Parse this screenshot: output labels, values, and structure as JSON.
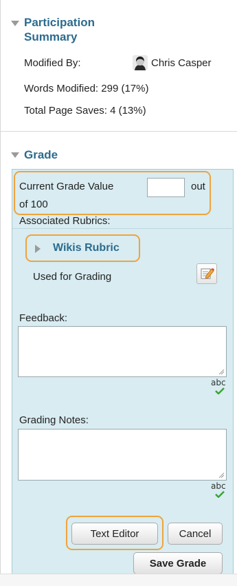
{
  "participation": {
    "title_line1": "Participation",
    "title_line2": "Summary",
    "modified_by_label": "Modified By:",
    "modified_by_name": "Chris Casper",
    "words_modified": "Words Modified: 299 (17%)",
    "total_page_saves": "Total Page Saves: 4 (13%)"
  },
  "grade": {
    "title": "Grade",
    "current_grade_label": "Current Grade Value",
    "grade_input_value": "",
    "out_of_part1": "out",
    "out_of_part2": "of 100",
    "associated_rubrics_label": "Associated Rubrics:",
    "rubric_name": "Wikis Rubric",
    "used_for_grading": "Used for Grading",
    "feedback_label": "Feedback:",
    "feedback_value": "",
    "grading_notes_label": "Grading Notes:",
    "grading_notes_value": "",
    "spellcheck_text": "abc",
    "buttons": {
      "text_editor": "Text Editor",
      "cancel": "Cancel",
      "save_grade": "Save Grade"
    }
  },
  "colors": {
    "link": "#2c6b8e",
    "panel": "#d8ecf1",
    "highlight": "#f0a33c",
    "check": "#3aa534"
  }
}
